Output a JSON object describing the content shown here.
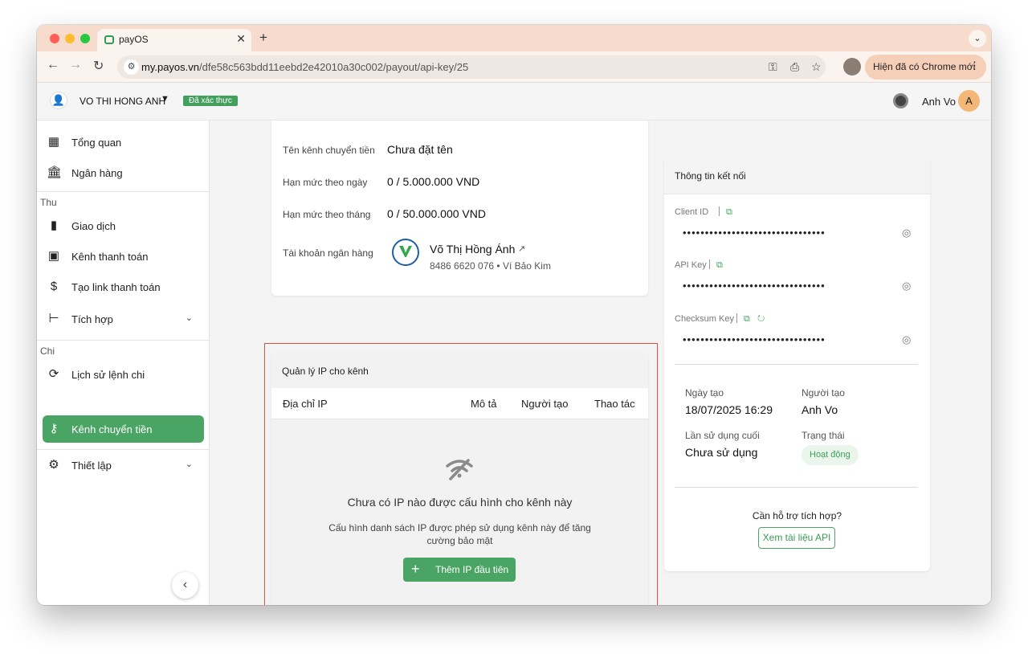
{
  "browser": {
    "tab_title": "payOS",
    "url_host": "my.payos.vn",
    "url_path": "/dfe58c563bdd11eebd2e42010a30c002/payout/api-key/25",
    "update_label": "Hiện đã có Chrome mới"
  },
  "header": {
    "org_name": "VO THI HONG ANH",
    "verified_badge": "Đã xác thực",
    "user_name": "Anh Vo",
    "avatar_initial": "A"
  },
  "sidebar": {
    "items": [
      {
        "label": "Tổng quan",
        "icon": "dashboard-icon"
      },
      {
        "label": "Ngân hàng",
        "icon": "bank-icon"
      },
      {
        "label": "Giao dịch",
        "icon": "bar-chart-icon"
      },
      {
        "label": "Kênh thanh toán",
        "icon": "wallet-icon"
      },
      {
        "label": "Tạo link thanh toán",
        "icon": "payment-link-icon"
      },
      {
        "label": "Tích hợp",
        "icon": "integration-icon"
      },
      {
        "label": "Lịch sử lệnh chi",
        "icon": "history-icon"
      },
      {
        "label": "Kênh chuyển tiền",
        "icon": "key-icon"
      },
      {
        "label": "Thiết lập",
        "icon": "settings-icon"
      }
    ],
    "group_thu": "Thu",
    "group_chi": "Chi"
  },
  "info_card": {
    "rows": [
      {
        "label": "Tên kênh chuyển tiền",
        "value": "Chưa đặt tên"
      },
      {
        "label": "Hạn mức theo ngày",
        "value": "0 / 5.000.000 VND"
      },
      {
        "label": "Hạn mức theo tháng",
        "value": "0 / 50.000.000 VND"
      }
    ],
    "bank_label": "Tài khoản ngân hàng",
    "bank_holder": "Võ Thị Hồng Ánh",
    "bank_account": "8486 6620 076 • Ví Bảo Kim"
  },
  "ip_card": {
    "title": "Quản lý IP cho kênh",
    "columns": [
      "Địa chỉ IP",
      "Mô tả",
      "Người tạo",
      "Thao tác"
    ],
    "empty_title": "Chưa có IP nào được cấu hình cho kênh này",
    "empty_desc": "Cấu hình danh sách IP được phép sử dụng kênh này để tăng cường bảo mật",
    "add_button": "Thêm IP đầu tiên"
  },
  "connection": {
    "title": "Thông tin kết nối",
    "keys": [
      {
        "label": "Client ID",
        "masked": "••••••••••••••••••••••••••••••••"
      },
      {
        "label": "API Key",
        "masked": "••••••••••••••••••••••••••••••••"
      },
      {
        "label": "Checksum Key",
        "masked": "••••••••••••••••••••••••••••••••"
      }
    ],
    "created_date_label": "Ngày tạo",
    "created_date": "18/07/2025 16:29",
    "creator_label": "Người tạo",
    "creator": "Anh Vo",
    "last_used_label": "Lần sử dụng cuối",
    "last_used": "Chưa sử dụng",
    "status_label": "Trạng thái",
    "status": "Hoạt động",
    "help_text": "Cần hỗ trợ tích hợp?",
    "doc_button": "Xem tài liệu API"
  },
  "colors": {
    "accent_green": "#4aa564",
    "highlight_frame": "#e0503a",
    "tab_strip": "#f7dccd"
  }
}
